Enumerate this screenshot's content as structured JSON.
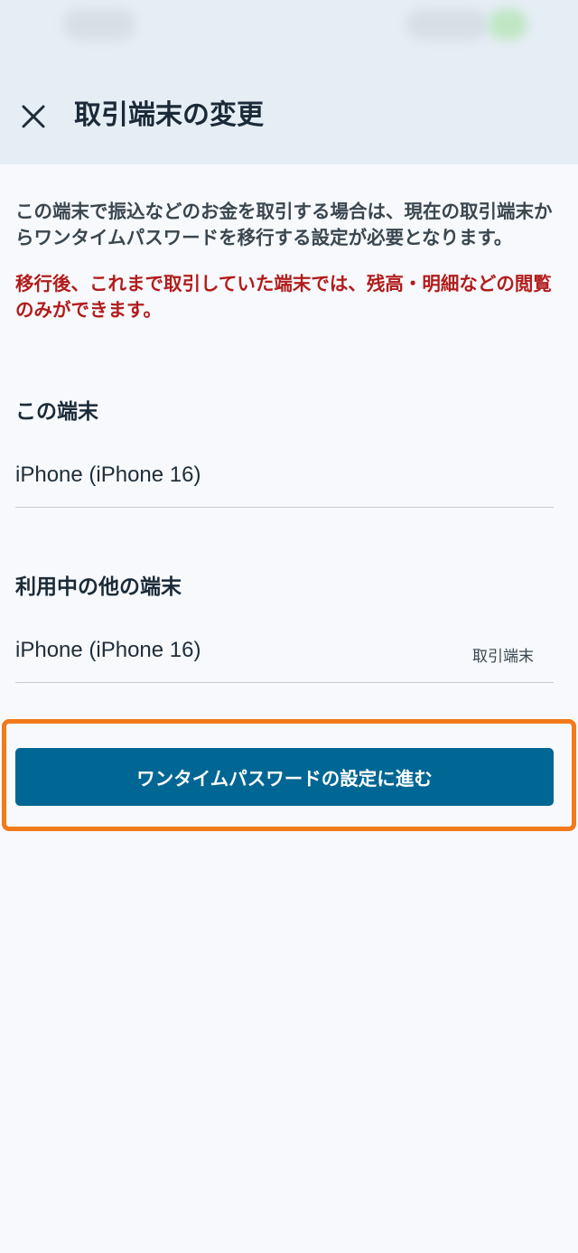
{
  "header": {
    "title": "取引端末の変更",
    "close_icon": "close-icon"
  },
  "notice": {
    "description": "この端末で振込などのお金を取引する場合は、現在の取引端末からワンタイムパスワードを移行する設定が必要となります。",
    "warning": "移行後、これまで取引していた端末では、残高・明細などの閲覧のみができます。"
  },
  "this_device": {
    "heading": "この端末",
    "name": "iPhone (iPhone 16)"
  },
  "other_devices": {
    "heading": "利用中の他の端末",
    "items": [
      {
        "name": "iPhone (iPhone 16)",
        "tag": "取引端末"
      }
    ]
  },
  "actions": {
    "proceed_label": "ワンタイムパスワードの設定に進む"
  },
  "colors": {
    "header_bg": "#e6eef5",
    "warning_text": "#b21c1c",
    "primary_button": "#006694",
    "highlight_border": "#f27a1a"
  }
}
